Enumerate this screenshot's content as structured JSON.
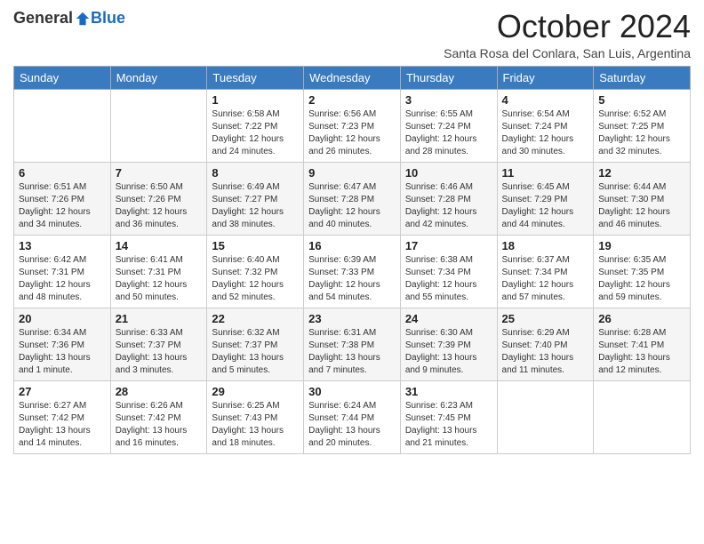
{
  "logo": {
    "general": "General",
    "blue": "Blue"
  },
  "title": "October 2024",
  "subtitle": "Santa Rosa del Conlara, San Luis, Argentina",
  "days_of_week": [
    "Sunday",
    "Monday",
    "Tuesday",
    "Wednesday",
    "Thursday",
    "Friday",
    "Saturday"
  ],
  "weeks": [
    [
      {
        "day": "",
        "info": ""
      },
      {
        "day": "",
        "info": ""
      },
      {
        "day": "1",
        "info": "Sunrise: 6:58 AM\nSunset: 7:22 PM\nDaylight: 12 hours\nand 24 minutes."
      },
      {
        "day": "2",
        "info": "Sunrise: 6:56 AM\nSunset: 7:23 PM\nDaylight: 12 hours\nand 26 minutes."
      },
      {
        "day": "3",
        "info": "Sunrise: 6:55 AM\nSunset: 7:24 PM\nDaylight: 12 hours\nand 28 minutes."
      },
      {
        "day": "4",
        "info": "Sunrise: 6:54 AM\nSunset: 7:24 PM\nDaylight: 12 hours\nand 30 minutes."
      },
      {
        "day": "5",
        "info": "Sunrise: 6:52 AM\nSunset: 7:25 PM\nDaylight: 12 hours\nand 32 minutes."
      }
    ],
    [
      {
        "day": "6",
        "info": "Sunrise: 6:51 AM\nSunset: 7:26 PM\nDaylight: 12 hours\nand 34 minutes."
      },
      {
        "day": "7",
        "info": "Sunrise: 6:50 AM\nSunset: 7:26 PM\nDaylight: 12 hours\nand 36 minutes."
      },
      {
        "day": "8",
        "info": "Sunrise: 6:49 AM\nSunset: 7:27 PM\nDaylight: 12 hours\nand 38 minutes."
      },
      {
        "day": "9",
        "info": "Sunrise: 6:47 AM\nSunset: 7:28 PM\nDaylight: 12 hours\nand 40 minutes."
      },
      {
        "day": "10",
        "info": "Sunrise: 6:46 AM\nSunset: 7:28 PM\nDaylight: 12 hours\nand 42 minutes."
      },
      {
        "day": "11",
        "info": "Sunrise: 6:45 AM\nSunset: 7:29 PM\nDaylight: 12 hours\nand 44 minutes."
      },
      {
        "day": "12",
        "info": "Sunrise: 6:44 AM\nSunset: 7:30 PM\nDaylight: 12 hours\nand 46 minutes."
      }
    ],
    [
      {
        "day": "13",
        "info": "Sunrise: 6:42 AM\nSunset: 7:31 PM\nDaylight: 12 hours\nand 48 minutes."
      },
      {
        "day": "14",
        "info": "Sunrise: 6:41 AM\nSunset: 7:31 PM\nDaylight: 12 hours\nand 50 minutes."
      },
      {
        "day": "15",
        "info": "Sunrise: 6:40 AM\nSunset: 7:32 PM\nDaylight: 12 hours\nand 52 minutes."
      },
      {
        "day": "16",
        "info": "Sunrise: 6:39 AM\nSunset: 7:33 PM\nDaylight: 12 hours\nand 54 minutes."
      },
      {
        "day": "17",
        "info": "Sunrise: 6:38 AM\nSunset: 7:34 PM\nDaylight: 12 hours\nand 55 minutes."
      },
      {
        "day": "18",
        "info": "Sunrise: 6:37 AM\nSunset: 7:34 PM\nDaylight: 12 hours\nand 57 minutes."
      },
      {
        "day": "19",
        "info": "Sunrise: 6:35 AM\nSunset: 7:35 PM\nDaylight: 12 hours\nand 59 minutes."
      }
    ],
    [
      {
        "day": "20",
        "info": "Sunrise: 6:34 AM\nSunset: 7:36 PM\nDaylight: 13 hours\nand 1 minute."
      },
      {
        "day": "21",
        "info": "Sunrise: 6:33 AM\nSunset: 7:37 PM\nDaylight: 13 hours\nand 3 minutes."
      },
      {
        "day": "22",
        "info": "Sunrise: 6:32 AM\nSunset: 7:37 PM\nDaylight: 13 hours\nand 5 minutes."
      },
      {
        "day": "23",
        "info": "Sunrise: 6:31 AM\nSunset: 7:38 PM\nDaylight: 13 hours\nand 7 minutes."
      },
      {
        "day": "24",
        "info": "Sunrise: 6:30 AM\nSunset: 7:39 PM\nDaylight: 13 hours\nand 9 minutes."
      },
      {
        "day": "25",
        "info": "Sunrise: 6:29 AM\nSunset: 7:40 PM\nDaylight: 13 hours\nand 11 minutes."
      },
      {
        "day": "26",
        "info": "Sunrise: 6:28 AM\nSunset: 7:41 PM\nDaylight: 13 hours\nand 12 minutes."
      }
    ],
    [
      {
        "day": "27",
        "info": "Sunrise: 6:27 AM\nSunset: 7:42 PM\nDaylight: 13 hours\nand 14 minutes."
      },
      {
        "day": "28",
        "info": "Sunrise: 6:26 AM\nSunset: 7:42 PM\nDaylight: 13 hours\nand 16 minutes."
      },
      {
        "day": "29",
        "info": "Sunrise: 6:25 AM\nSunset: 7:43 PM\nDaylight: 13 hours\nand 18 minutes."
      },
      {
        "day": "30",
        "info": "Sunrise: 6:24 AM\nSunset: 7:44 PM\nDaylight: 13 hours\nand 20 minutes."
      },
      {
        "day": "31",
        "info": "Sunrise: 6:23 AM\nSunset: 7:45 PM\nDaylight: 13 hours\nand 21 minutes."
      },
      {
        "day": "",
        "info": ""
      },
      {
        "day": "",
        "info": ""
      }
    ]
  ]
}
